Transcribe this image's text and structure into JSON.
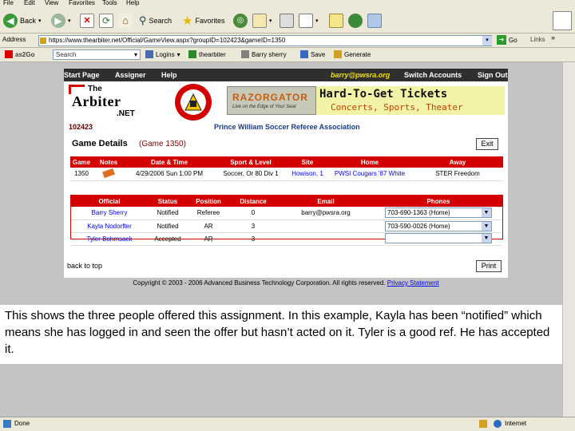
{
  "browser": {
    "menu": [
      "File",
      "Edit",
      "View",
      "Favorites",
      "Tools",
      "Help"
    ],
    "toolbar": {
      "back_label": "Back",
      "search_label": "Search",
      "favorites_label": "Favorites"
    },
    "address": {
      "label": "Address",
      "url": "https://www.thearbiter.net/Official/GameView.aspx?groupID=102423&gameID=1350",
      "go_label": "Go",
      "links_label": "Links"
    },
    "links": {
      "search_label": "Search",
      "logins_label": "Logins",
      "thearbiter_label": "thearbiter",
      "barry_label": "Barry sherry",
      "save_label": "Save",
      "generate_label": "Generate"
    },
    "status": {
      "left": "Done",
      "zone": "Internet"
    }
  },
  "site": {
    "nav": {
      "start": "Start Page",
      "assigner": "Assigner",
      "help": "Help",
      "email": "barry@pwsra.org",
      "switch": "Switch Accounts",
      "signout": "Sign Out"
    },
    "logo": {
      "line1": "The",
      "line2": "Arbiter",
      "line3": ".NET"
    },
    "razor": {
      "brand": "RAZORGATOR",
      "tag": "Live on the Edge of Your Seat"
    },
    "tickets": {
      "line1": "Hard-To-Get Tickets",
      "line2": "Concerts, Sports, Theater"
    },
    "group_id": "102423",
    "association": "Prince William Soccer Referee Association"
  },
  "game": {
    "title": "Game Details",
    "subtitle": "(Game 1350)",
    "exit_label": "Exit",
    "headers": [
      "Game",
      "Notes",
      "Date & Time",
      "Sport & Level",
      "Site",
      "Home",
      "Away"
    ],
    "row": {
      "game": "1350",
      "date": "4/29/2006 Sun 1:00 PM",
      "sport": "Soccer, Or 80 Div 1",
      "site": "Howison, 1",
      "home": "PWSI Cougars '87 White",
      "away": "STER Freedom"
    }
  },
  "officials": {
    "headers": [
      "Official",
      "Status",
      "Position",
      "Distance",
      "Email",
      "Phones"
    ],
    "rows": [
      {
        "name": "Barry Sherry",
        "status": "Notified",
        "position": "Referee",
        "distance": "0",
        "email": "barry@pwsra.org",
        "phone": "703-690-1363 (Home)"
      },
      {
        "name": "Kayla Nodorfter",
        "status": "Notified",
        "position": "AR",
        "distance": "3",
        "email": "",
        "phone": "703-590-0026 (Home)"
      },
      {
        "name": "Tyler Bohmsack",
        "status": "Accepted",
        "position": "AR",
        "distance": "3",
        "email": "",
        "phone": ""
      }
    ],
    "back_label": "back to top",
    "print_label": "Print"
  },
  "copyright": "Copyright © 2003 - 2006 Advanced Business Technology Corporation. All rights reserved.",
  "privacy_label": "Privacy Statement",
  "caption": "This shows the three people offered this assignment. In this example, Kayla has been “notified” which means she has logged in and seen the offer but hasn’t acted on it.  Tyler is a good ref. He has accepted it."
}
